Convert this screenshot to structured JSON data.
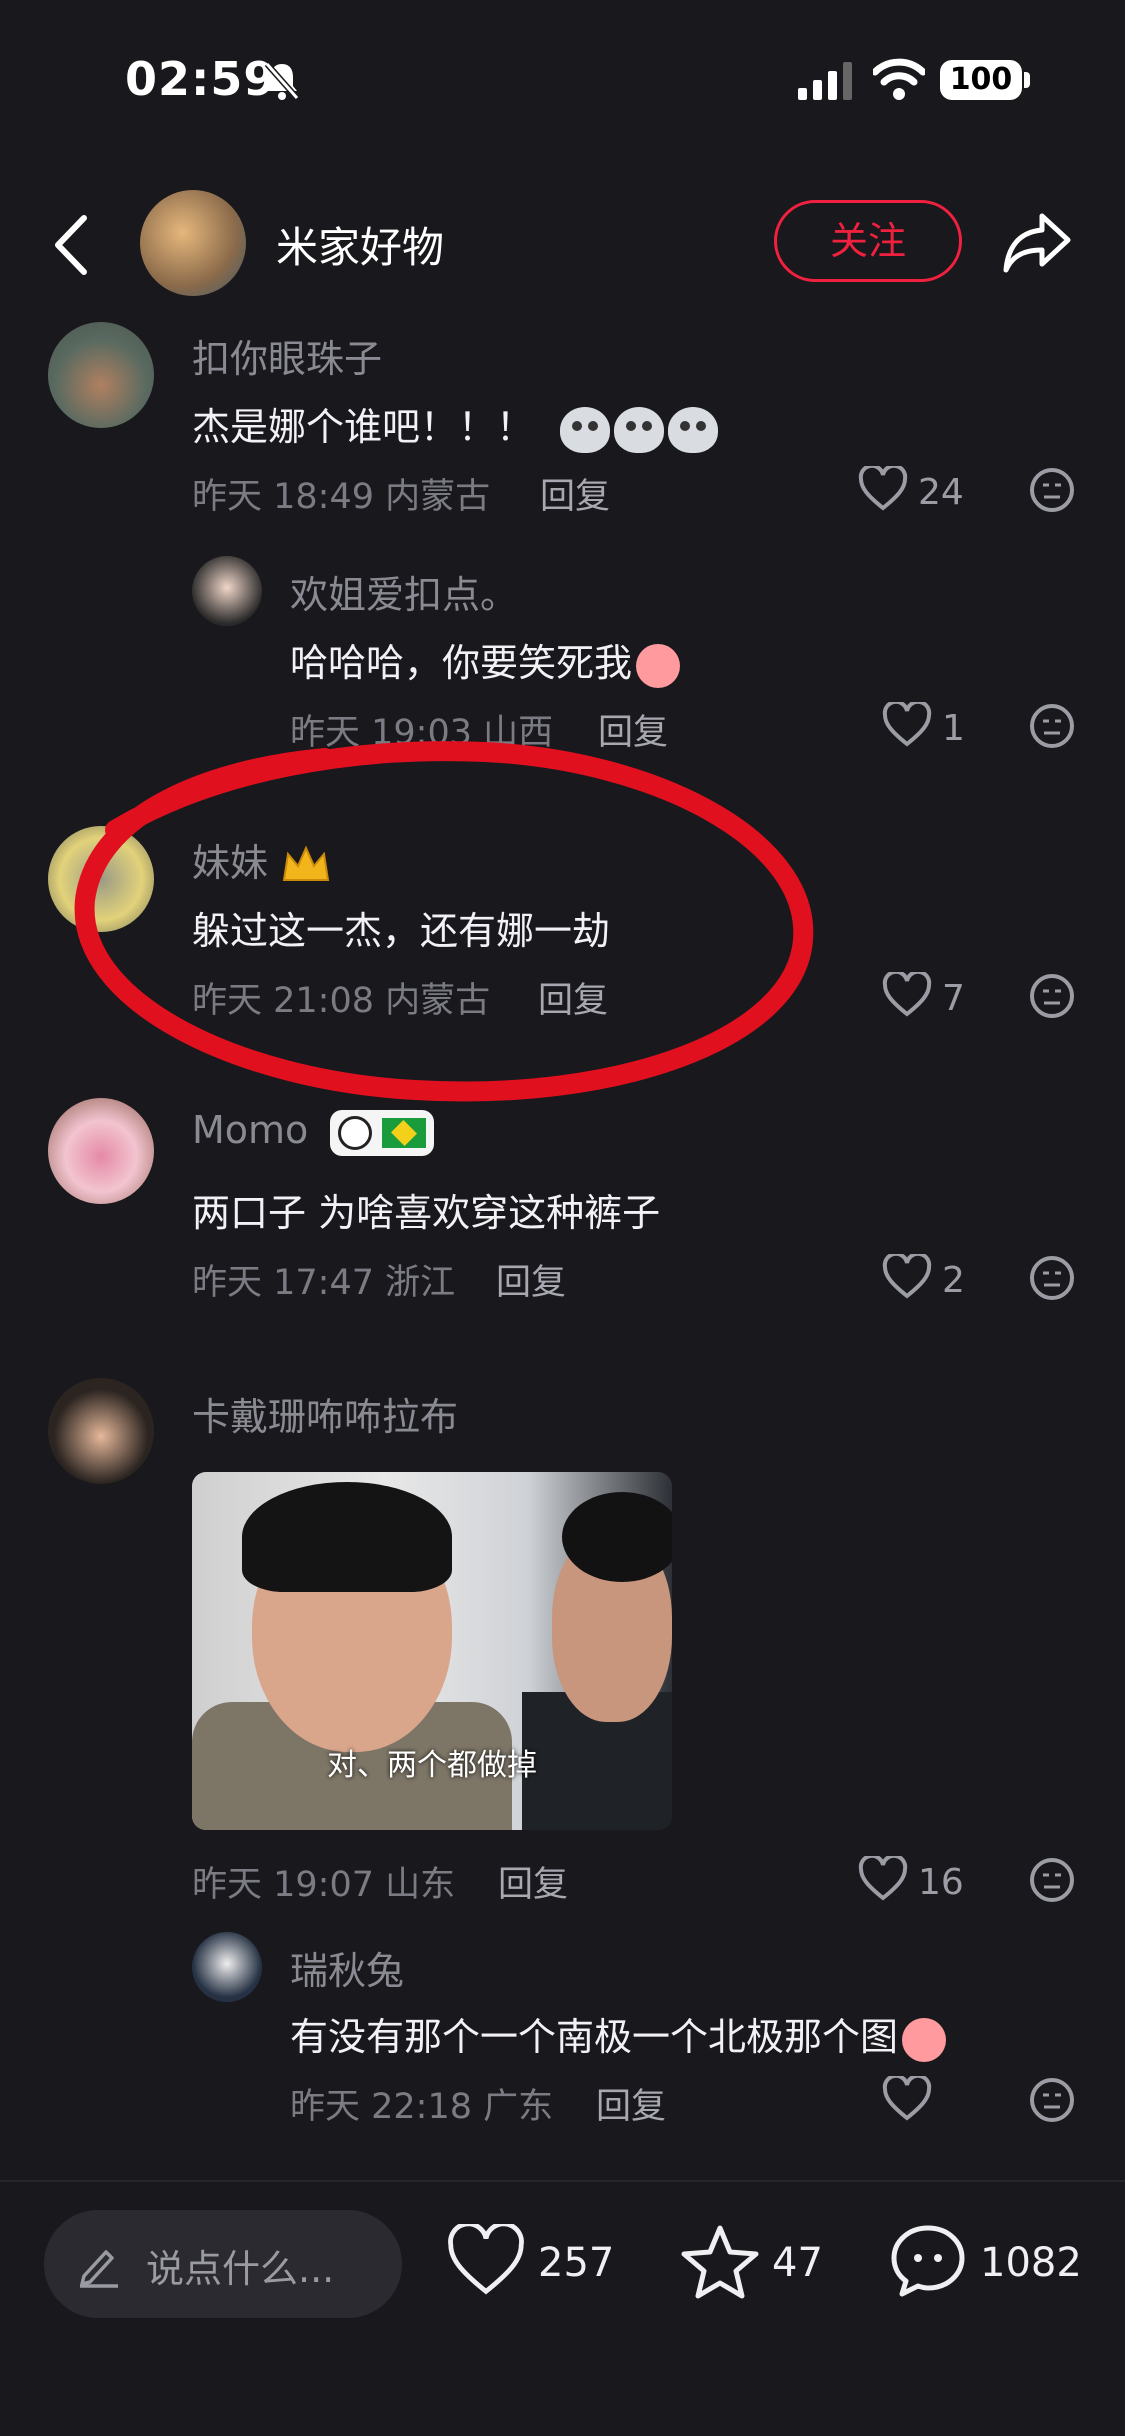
{
  "status": {
    "time": "02:59",
    "battery": "100"
  },
  "header": {
    "title": "米家好物",
    "follow_label": "关注"
  },
  "comments": [
    {
      "name": "扣你眼珠子",
      "text": "杰是娜个谁吧！！！",
      "meta": "昨天 18:49 内蒙古",
      "reply": "回复",
      "likes": "24"
    },
    {
      "name": "欢姐爱扣点。",
      "text": "哈哈哈，你要笑死我",
      "meta": "昨天 19:03 山西",
      "reply": "回复",
      "likes": "1"
    },
    {
      "name": "妹妹",
      "text": "躲过这一杰，还有娜一劫",
      "meta": "昨天 21:08 内蒙古",
      "reply": "回复",
      "likes": "7"
    },
    {
      "name": "Momo",
      "text": "两口子 为啥喜欢穿这种裤子",
      "meta": "昨天 17:47 浙江",
      "reply": "回复",
      "likes": "2"
    },
    {
      "name": "卡戴珊咘咘拉布",
      "image_caption": "对、两个都做掉",
      "meta": "昨天 19:07 山东",
      "reply": "回复",
      "likes": "16"
    },
    {
      "name": "瑞秋兔",
      "text": "有没有那个一个南极一个北极那个图",
      "meta": "昨天 22:18 广东",
      "reply": "回复",
      "likes": ""
    }
  ],
  "bottom": {
    "input_placeholder": "说点什么...",
    "likes": "257",
    "stars": "47",
    "comments": "1082"
  },
  "colors": {
    "accent": "#f0203f",
    "background": "#18181d",
    "highlight": "#e0101e"
  }
}
